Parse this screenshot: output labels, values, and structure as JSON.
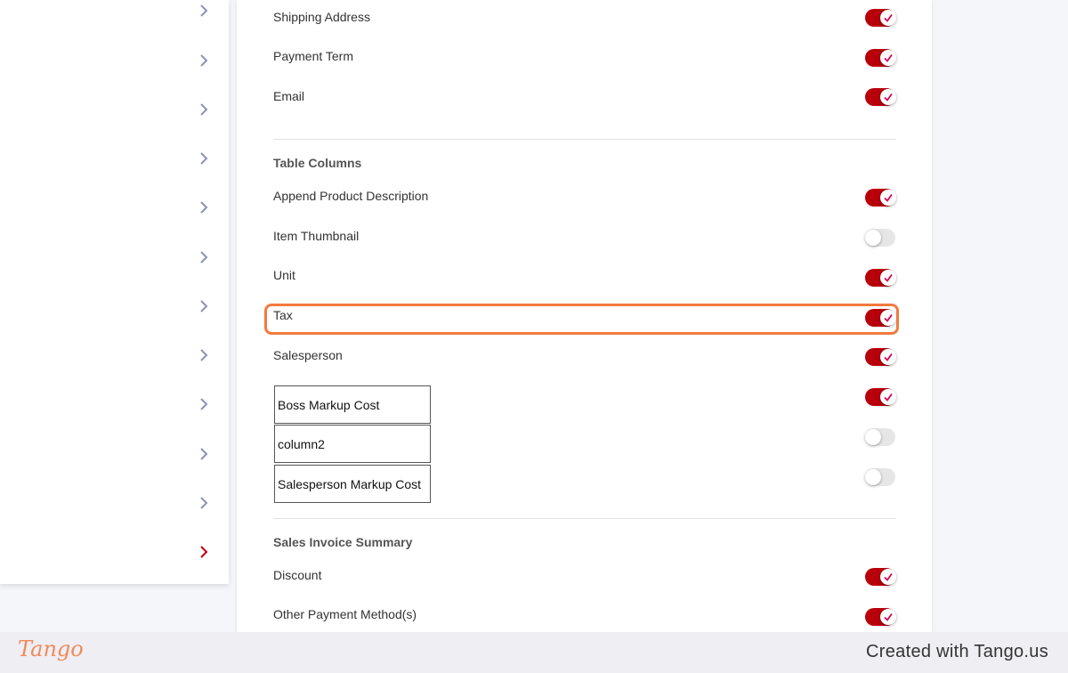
{
  "sidebar": {
    "chevrons": [
      {
        "state": "default"
      },
      {
        "state": "default"
      },
      {
        "state": "default"
      },
      {
        "state": "default"
      },
      {
        "state": "default"
      },
      {
        "state": "default"
      },
      {
        "state": "default"
      },
      {
        "state": "default"
      },
      {
        "state": "default"
      },
      {
        "state": "default"
      },
      {
        "state": "default"
      },
      {
        "state": "active"
      }
    ],
    "chevron_color": "#8b93b8",
    "chevron_active_color": "#c0000a"
  },
  "settings": {
    "header_rows": [
      {
        "label": "Shipping Address",
        "enabled": true
      },
      {
        "label": "Payment Term",
        "enabled": true
      },
      {
        "label": "Email",
        "enabled": true
      }
    ],
    "table_columns": {
      "title": "Table Columns",
      "rows": [
        {
          "label": "Append Product Description",
          "enabled": true
        },
        {
          "label": "Item Thumbnail",
          "enabled": false
        },
        {
          "label": "Unit",
          "enabled": true
        },
        {
          "label": "Tax",
          "enabled": true
        },
        {
          "label": "Salesperson",
          "enabled": true
        }
      ],
      "custom_columns": [
        {
          "label": "Boss Markup Cost",
          "enabled": true
        },
        {
          "label": "column2",
          "enabled": false
        },
        {
          "label": "Salesperson Markup Cost",
          "enabled": false
        }
      ]
    },
    "summary": {
      "title": "Sales Invoice Summary",
      "rows": [
        {
          "label": "Discount",
          "enabled": true
        },
        {
          "label": "Other Payment Method(s)",
          "enabled": true
        }
      ]
    }
  },
  "colors": {
    "toggle_on": "#b8000b",
    "toggle_off": "#e6e6e6",
    "highlight": "#f27a3f"
  },
  "footer": {
    "logo": "Tango",
    "created_with": "Created with Tango.us"
  }
}
